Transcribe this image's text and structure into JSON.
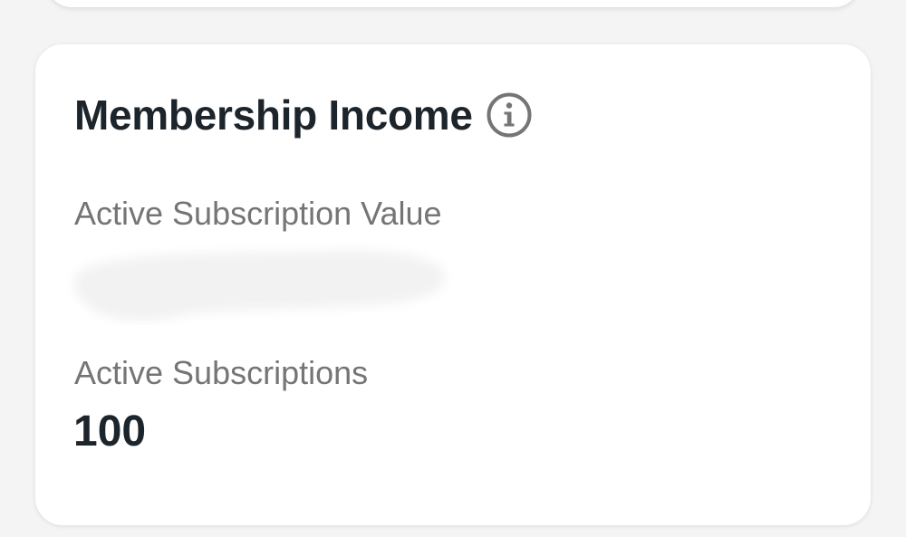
{
  "card": {
    "title": "Membership Income",
    "info_icon": "info-icon",
    "active_subscription_value": {
      "label": "Active Subscription Value",
      "value": ""
    },
    "active_subscriptions": {
      "label": "Active Subscriptions",
      "count": "100"
    }
  },
  "colors": {
    "background": "#f4f4f4",
    "card": "#ffffff",
    "title_text": "#1d252c",
    "label_text": "#757575",
    "icon": "#757575"
  }
}
